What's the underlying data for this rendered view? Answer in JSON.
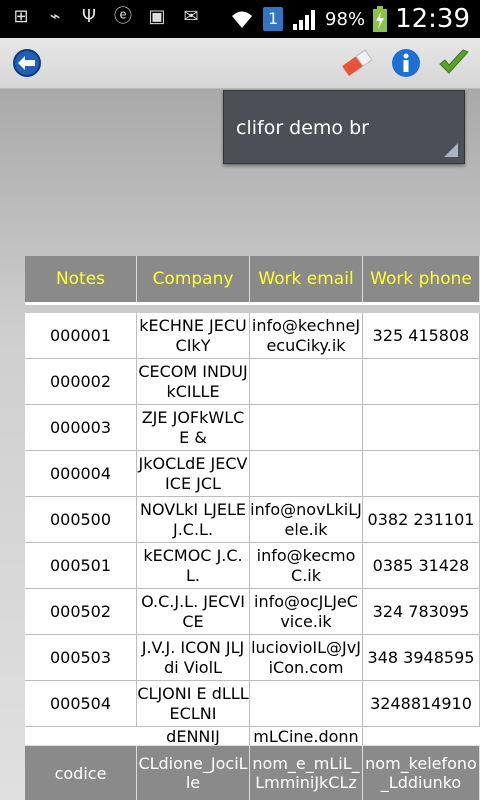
{
  "status_bar": {
    "battery": "98%",
    "time": "12:39",
    "sim": "1",
    "icons": [
      "add-icon",
      "broom-icon",
      "usb-icon",
      "e-app-icon",
      "image-icon",
      "mail-icon",
      "wifi-icon",
      "sim-icon",
      "signal-icon",
      "battery-charging-icon"
    ]
  },
  "toolbar": {
    "back": "back-icon",
    "eraser": "eraser-icon",
    "info": "info-icon",
    "confirm": "check-icon"
  },
  "filter": {
    "value": "clifor demo br"
  },
  "columns": [
    "Notes",
    "Company",
    "Work email",
    "Work phone"
  ],
  "rows": [
    [
      "000001",
      "kECHNE JECUCIkY",
      "info@kechneJecuCiky.ik",
      "325 415808"
    ],
    [
      "000002",
      "CECOM INDUJkCILLE",
      "",
      ""
    ],
    [
      "000003",
      "ZJE JOFkWLCE &",
      "",
      ""
    ],
    [
      "000004",
      "JkOCLdE JECVICE JCL",
      "",
      ""
    ],
    [
      "000500",
      "NOVLkI LJELE J.C.L.",
      "info@novLkiLJele.ik",
      "0382 231101"
    ],
    [
      "000501",
      "kECMOC J.C.L.",
      "info@kecmoC.ik",
      "0385 31428"
    ],
    [
      "000502",
      "O.C.J.L. JECVICE",
      "info@ocJLJeCvice.ik",
      "324 783095"
    ],
    [
      "000503",
      "J.V.J. ICON JLJ di ViolL",
      "luciovioIL@JvJiCon.com",
      "348 3948595"
    ],
    [
      "000504",
      "CLJONI E dLLLECLNI",
      "",
      "3248814910"
    ],
    [
      "",
      "dENNIJ",
      "mLCine.donn",
      ""
    ]
  ],
  "footer": [
    "codice",
    "CLdione_JociLle",
    "nom_e_mLiL_LmminiJkCLz",
    "nom_kelefono_Lddiunko"
  ]
}
